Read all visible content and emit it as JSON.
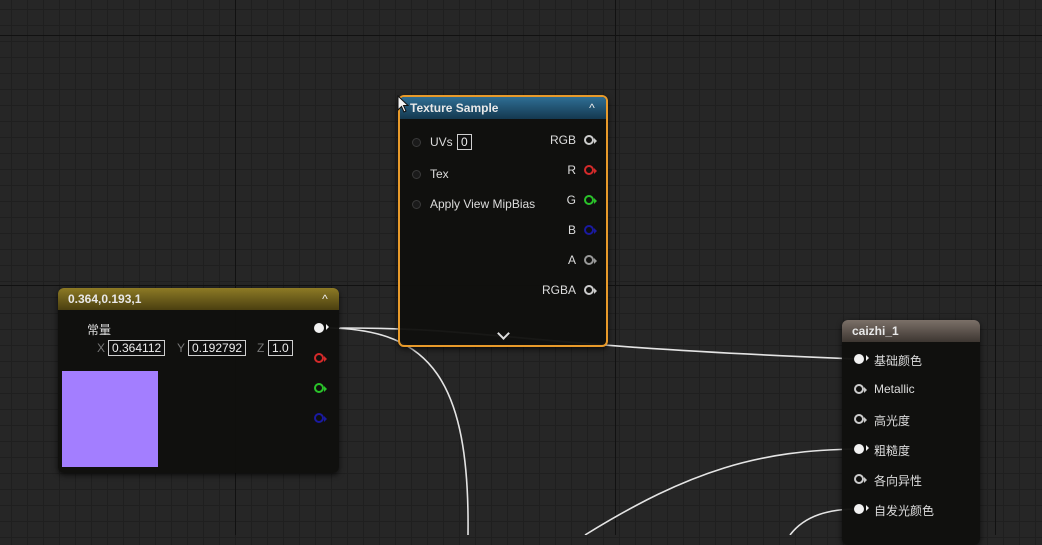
{
  "texture_node": {
    "title": "Texture Sample",
    "inputs": {
      "uvs_label": "UVs",
      "uvs_value": "0",
      "tex_label": "Tex",
      "mipbias_label": "Apply View MipBias"
    },
    "outputs": [
      "RGB",
      "R",
      "G",
      "B",
      "A",
      "RGBA"
    ],
    "expand_icon": "chevron-down-icon"
  },
  "constant_node": {
    "title": "0.364,0.193,1",
    "output_label": "常量",
    "x_label": "X",
    "x_value": "0.364112",
    "y_label": "Y",
    "y_value": "0.192792",
    "z_label": "Z",
    "z_value": "1.0",
    "preview_color": "#a37eff"
  },
  "material_node": {
    "title": "caizhi_1",
    "inputs": [
      "基础颜色",
      "Metallic",
      "高光度",
      "粗糙度",
      "各向异性",
      "自发光颜色"
    ]
  },
  "colors": {
    "texture_border": "#e89a2a",
    "texture_header": "#1f4a66",
    "constant_header": "#6b5a17",
    "material_header": "#5d534c",
    "pin_red": "#d42a2a",
    "pin_green": "#2ac32a",
    "pin_blue": "#1a1aa0"
  }
}
